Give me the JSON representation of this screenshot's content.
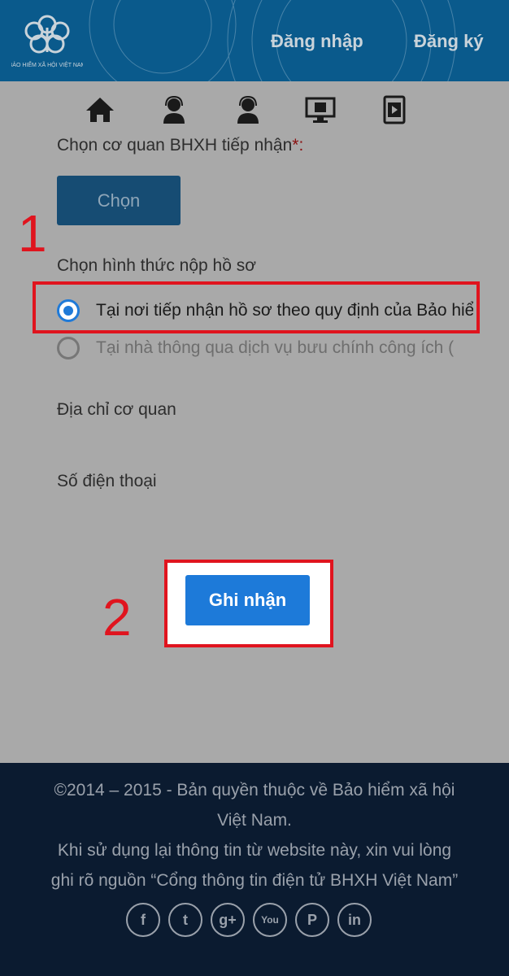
{
  "header": {
    "logo_text": "BẢO HIỂM XÃ HỘI VIỆT NAM",
    "login": "Đăng nhập",
    "register": "Đăng ký"
  },
  "toolbar": {
    "icons": [
      "home-icon",
      "support-agent-icon",
      "support-agent-icon",
      "monitor-icon",
      "video-library-icon"
    ]
  },
  "form": {
    "agency_label": "Chọn cơ quan BHXH tiếp nhận",
    "required_mark": "*:",
    "choose_button": "Chọn",
    "method_label": "Chọn hình thức nộp hồ sơ",
    "options": [
      {
        "label": "Tại nơi tiếp nhận hồ sơ theo quy định của Bảo hiểm xã hội",
        "selected": true
      },
      {
        "label": "Tại nhà thông qua dịch vụ bưu chính công ích (",
        "selected": false
      }
    ],
    "address_label": "Địa chỉ cơ quan",
    "phone_label": "Số điện thoại",
    "submit_button": "Ghi nhận"
  },
  "annotations": {
    "step1": "1",
    "step2": "2",
    "highlight_color": "#e0141e"
  },
  "footer": {
    "line1": "©2014 – 2015 - Bản quyền thuộc về Bảo hiểm xã hội",
    "line2": "Việt Nam.",
    "line3": "Khi sử dụng lại thông tin từ website này, xin vui lòng",
    "line4": "ghi rõ nguồn “Cổng thông tin điện tử BHXH Việt Nam”",
    "social": [
      "facebook-icon",
      "twitter-icon",
      "google-plus-icon",
      "youtube-icon",
      "pinterest-icon",
      "linkedin-icon"
    ],
    "social_glyphs": [
      "f",
      "t",
      "g+",
      "You",
      "P",
      "in"
    ]
  }
}
